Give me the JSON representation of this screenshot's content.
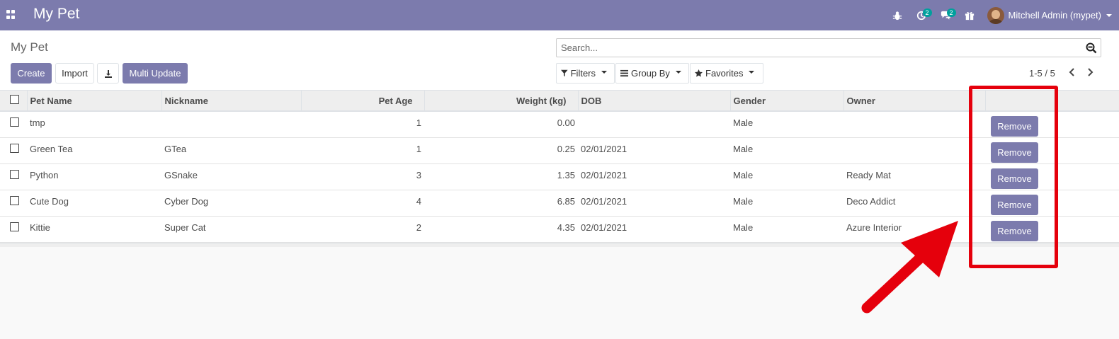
{
  "navbar": {
    "brand": "My Pet",
    "activity_count": "2",
    "messages_count": "2",
    "user_name": "Mitchell Admin (mypet)"
  },
  "control_panel": {
    "title": "My Pet",
    "create_label": "Create",
    "import_label": "Import",
    "multi_update_label": "Multi Update",
    "search_placeholder": "Search...",
    "filters_label": "Filters",
    "group_by_label": "Group By",
    "favorites_label": "Favorites",
    "pager_value": "1-5 / 5"
  },
  "table": {
    "columns": [
      "Pet Name",
      "Nickname",
      "Pet Age",
      "Weight (kg)",
      "DOB",
      "Gender",
      "Owner"
    ],
    "rows": [
      {
        "pet_name": "tmp",
        "nickname": "",
        "pet_age": "1",
        "weight": "0.00",
        "dob": "",
        "gender": "Male",
        "owner": "",
        "action": "Remove"
      },
      {
        "pet_name": "Green Tea",
        "nickname": "GTea",
        "pet_age": "1",
        "weight": "0.25",
        "dob": "02/01/2021",
        "gender": "Male",
        "owner": "",
        "action": "Remove"
      },
      {
        "pet_name": "Python",
        "nickname": "GSnake",
        "pet_age": "3",
        "weight": "1.35",
        "dob": "02/01/2021",
        "gender": "Male",
        "owner": "Ready Mat",
        "action": "Remove"
      },
      {
        "pet_name": "Cute Dog",
        "nickname": "Cyber Dog",
        "pet_age": "4",
        "weight": "6.85",
        "dob": "02/01/2021",
        "gender": "Male",
        "owner": "Deco Addict",
        "action": "Remove"
      },
      {
        "pet_name": "Kittie",
        "nickname": "Super Cat",
        "pet_age": "2",
        "weight": "4.35",
        "dob": "02/01/2021",
        "gender": "Male",
        "owner": "Azure Interior",
        "action": "Remove"
      }
    ]
  },
  "colors": {
    "brand": "#7c7bad",
    "annotation": "#e5000c"
  },
  "icons": [
    "apps-icon",
    "bug-icon",
    "activity-icon",
    "chat-icon",
    "gift-icon",
    "download-icon",
    "search-icon",
    "filter-icon",
    "list-icon",
    "star-icon",
    "chevron-left-icon",
    "chevron-right-icon"
  ]
}
